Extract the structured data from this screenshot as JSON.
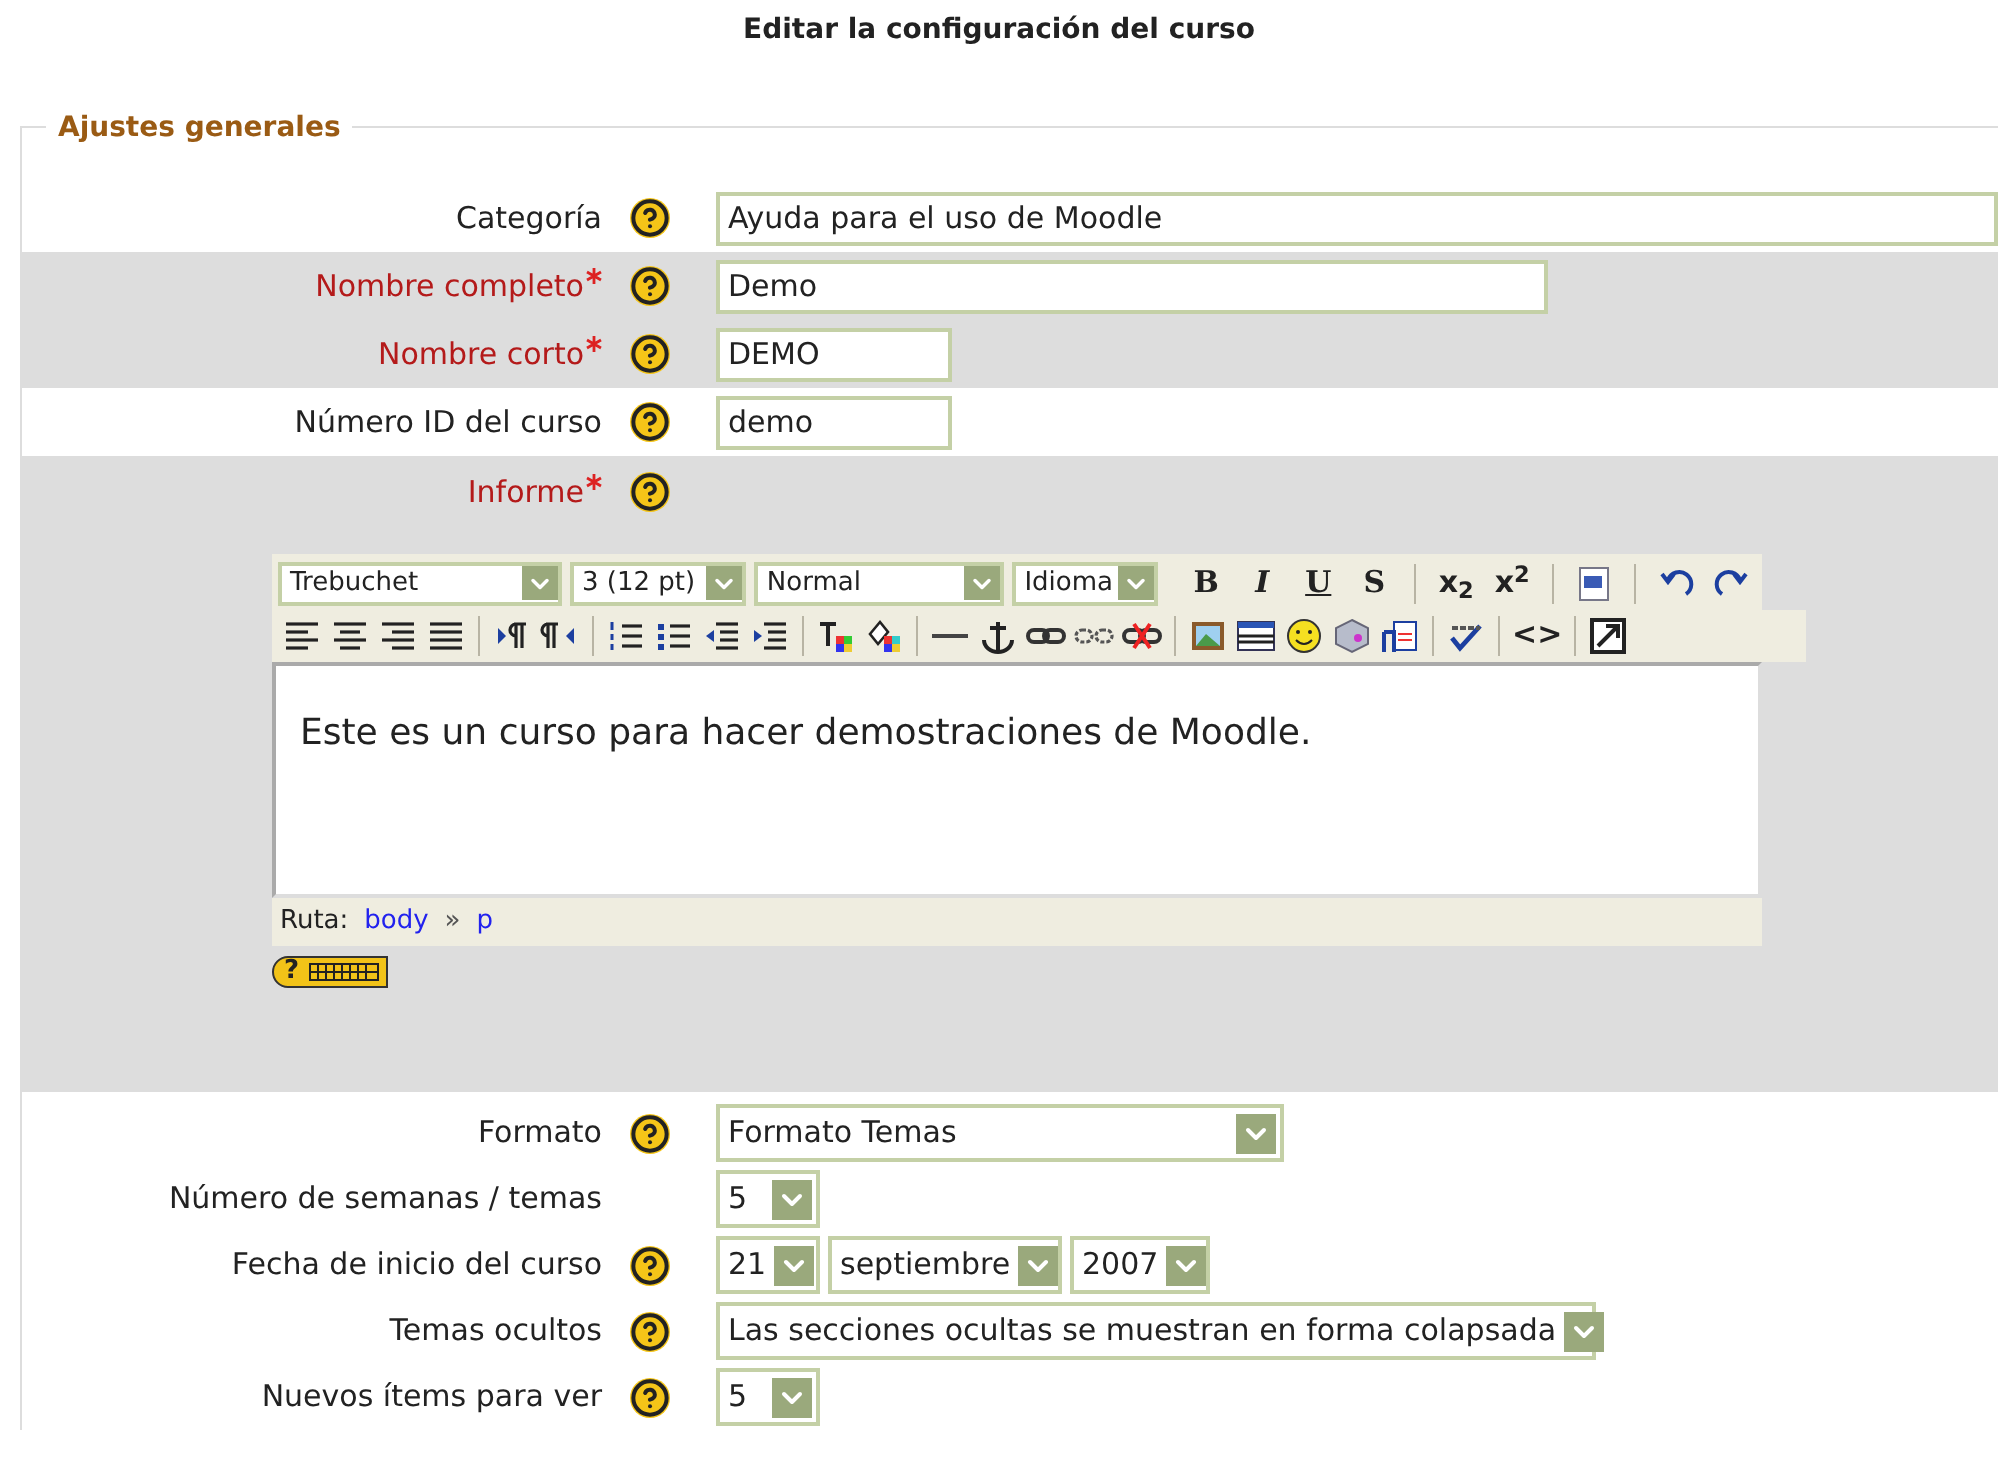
{
  "page_title": "Editar la configuración del curso",
  "section": {
    "legend": "Ajustes generales"
  },
  "rows": [
    {
      "kind": "field",
      "label": "Categoría",
      "required": false,
      "help": true,
      "fields": [
        {
          "kind": "input",
          "value": "Ayuda para el uso de Moodle"
        }
      ]
    },
    {
      "kind": "field",
      "label": "Nombre completo",
      "required": true,
      "help": true,
      "fields": [
        {
          "kind": "input",
          "value": "Demo"
        }
      ]
    },
    {
      "kind": "field",
      "label": "Nombre corto",
      "required": true,
      "help": true,
      "fields": [
        {
          "kind": "input",
          "value": "DEMO"
        }
      ]
    },
    {
      "kind": "field",
      "label": "Número ID del curso",
      "required": false,
      "help": true,
      "fields": [
        {
          "kind": "input",
          "value": "demo"
        }
      ]
    },
    {
      "kind": "editor",
      "label": "Informe",
      "required": true,
      "help": true,
      "editor": {
        "selects": [
          "Trebuchet",
          "3 (12 pt)",
          "Normal",
          "Idioma"
        ],
        "style_glyphs": [
          "B",
          "I",
          "U",
          "S"
        ],
        "script_glyphs": [
          "x$_{2}$",
          "x$^{2}$"
        ],
        "html_glyph": "<>",
        "content": "Este es un curso para hacer demostraciones de Moodle.",
        "path_label": "Ruta:",
        "path": [
          "body",
          "p"
        ],
        "path_separator": "»",
        "help_glyph": "?"
      }
    },
    {
      "kind": "field",
      "label": "Formato",
      "required": false,
      "help": true,
      "fields": [
        {
          "kind": "select",
          "value": "Formato Temas"
        }
      ]
    },
    {
      "kind": "field",
      "label": "Número de semanas / temas",
      "required": false,
      "help": false,
      "fields": [
        {
          "kind": "select",
          "value": "5"
        }
      ]
    },
    {
      "kind": "field",
      "label": "Fecha de inicio del curso",
      "required": false,
      "help": true,
      "fields": [
        {
          "kind": "select",
          "value": "21"
        },
        {
          "kind": "select",
          "value": "septiembre"
        },
        {
          "kind": "select",
          "value": "2007"
        }
      ]
    },
    {
      "kind": "field",
      "label": "Temas ocultos",
      "required": false,
      "help": true,
      "fields": [
        {
          "kind": "select",
          "value": "Las secciones ocultas se muestran en forma colapsada"
        }
      ]
    },
    {
      "kind": "field",
      "label": "Nuevos ítems para ver",
      "required": false,
      "help": true,
      "fields": [
        {
          "kind": "select",
          "value": "5"
        }
      ]
    }
  ]
}
